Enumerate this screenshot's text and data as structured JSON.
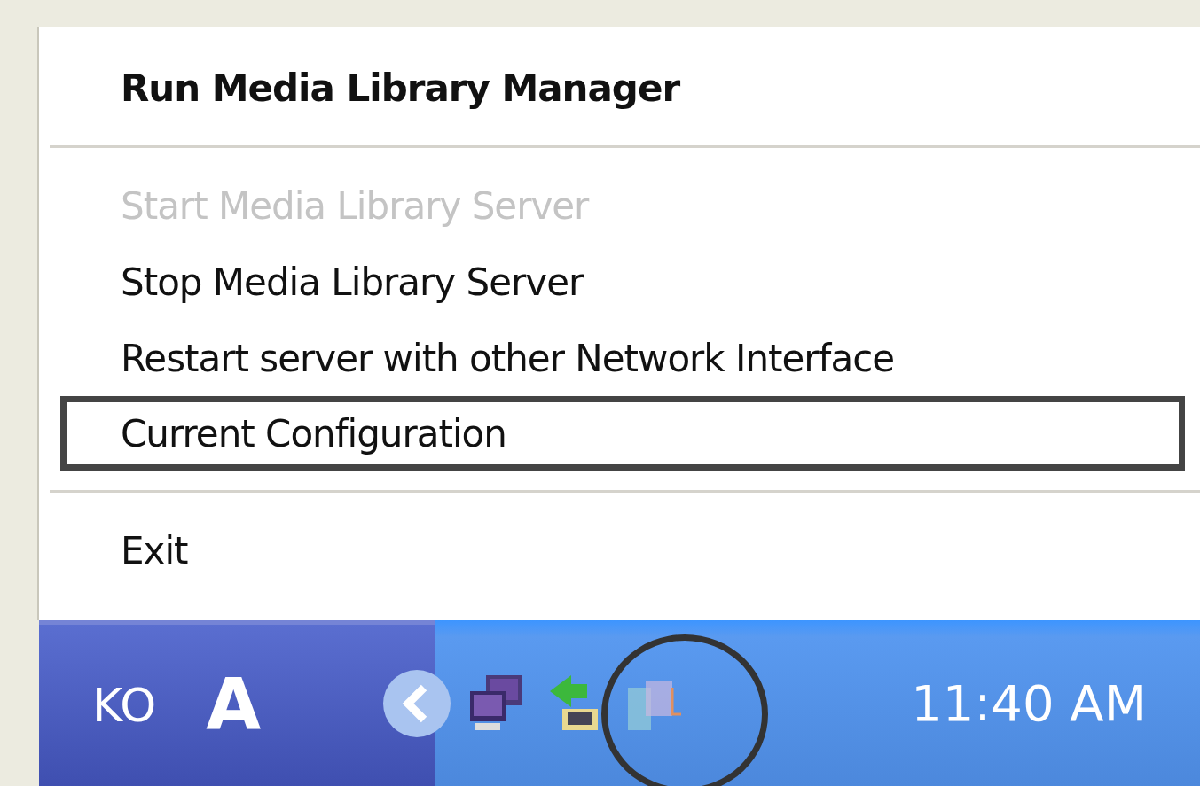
{
  "menu": {
    "items": [
      {
        "kind": "item",
        "label": "Run Media Library Manager",
        "bold": true,
        "disabled": false,
        "outlined": false
      },
      {
        "kind": "separator"
      },
      {
        "kind": "item",
        "label": "Start Media Library Server",
        "bold": false,
        "disabled": true,
        "outlined": false
      },
      {
        "kind": "item",
        "label": "Stop Media Library Server",
        "bold": false,
        "disabled": false,
        "outlined": false
      },
      {
        "kind": "item",
        "label": "Restart server with other Network Interface",
        "bold": false,
        "disabled": false,
        "outlined": false
      },
      {
        "kind": "item",
        "label": "Current Configuration",
        "bold": false,
        "disabled": false,
        "outlined": true
      },
      {
        "kind": "separator"
      },
      {
        "kind": "item",
        "label": "Exit",
        "bold": false,
        "disabled": false,
        "outlined": false
      }
    ]
  },
  "taskbar": {
    "language": "KO",
    "ime": "A",
    "tray_icons": [
      {
        "kind": "network",
        "circled": false
      },
      {
        "kind": "transfer",
        "circled": false
      },
      {
        "kind": "media",
        "circled": true
      }
    ],
    "clock": "11:40 AM"
  }
}
